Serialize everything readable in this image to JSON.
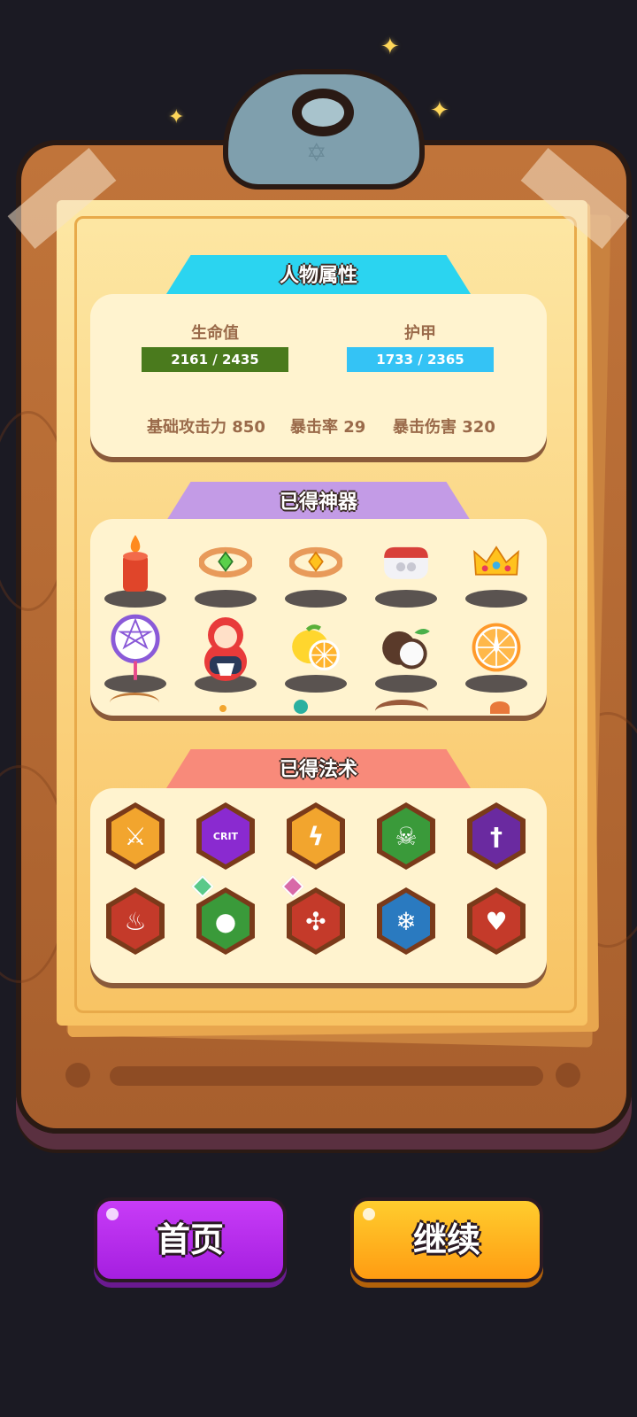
{
  "colors": {
    "background": "#1b1a23",
    "hp_bar": "#4a7a1d",
    "armor_bar": "#34c3f5",
    "stats_tab": "#2bd4f0",
    "artifacts_tab": "#c39be6",
    "spells_tab": "#f88a7a",
    "home_button": "#b12ae9",
    "continue_button": "#ffb21e"
  },
  "stats": {
    "title": "人物属性",
    "hp_label": "生命值",
    "hp_value": "2161 / 2435",
    "hp_current": 2161,
    "hp_max": 2435,
    "armor_label": "护甲",
    "armor_value": "1733 / 2365",
    "armor_current": 1733,
    "armor_max": 2365,
    "attack": "基础攻击力 850",
    "crit_rate": "暴击率 29",
    "crit_damage": "暴击伤害 320"
  },
  "artifacts": {
    "title": "已得神器",
    "items": [
      {
        "icon": "candle-icon"
      },
      {
        "icon": "green-gem-bracelet-icon"
      },
      {
        "icon": "orange-gem-bracelet-icon"
      },
      {
        "icon": "earbuds-case-icon"
      },
      {
        "icon": "crown-icon"
      },
      {
        "icon": "dreamcatcher-icon"
      },
      {
        "icon": "nesting-doll-icon"
      },
      {
        "icon": "lemon-icon"
      },
      {
        "icon": "coconut-icon"
      },
      {
        "icon": "orange-slice-icon"
      }
    ]
  },
  "spells": {
    "title": "已得法术",
    "items": [
      {
        "icon": "crossed-swords-icon",
        "color": "#f2a52e"
      },
      {
        "icon": "crit-burst-icon",
        "color": "#8a2ad0",
        "label": "CRIT"
      },
      {
        "icon": "lightning-shield-icon",
        "color": "#f2a52e"
      },
      {
        "icon": "poison-skull-icon",
        "color": "#3a9a3a"
      },
      {
        "icon": "sword-shield-icon",
        "color": "#6a2aa0"
      },
      {
        "icon": "fire-shield-icon",
        "color": "#c43a2a"
      },
      {
        "icon": "sheep-icon",
        "color": "#3a9a3a",
        "gem": "#5ac98a"
      },
      {
        "icon": "spinning-blades-icon",
        "color": "#c43a2a",
        "gem": "#d86aa8"
      },
      {
        "icon": "ice-snowflake-icon",
        "color": "#2a7ac0"
      },
      {
        "icon": "heart-pulse-icon",
        "color": "#c43a2a"
      }
    ]
  },
  "buttons": {
    "home": "首页",
    "continue": "继续"
  }
}
